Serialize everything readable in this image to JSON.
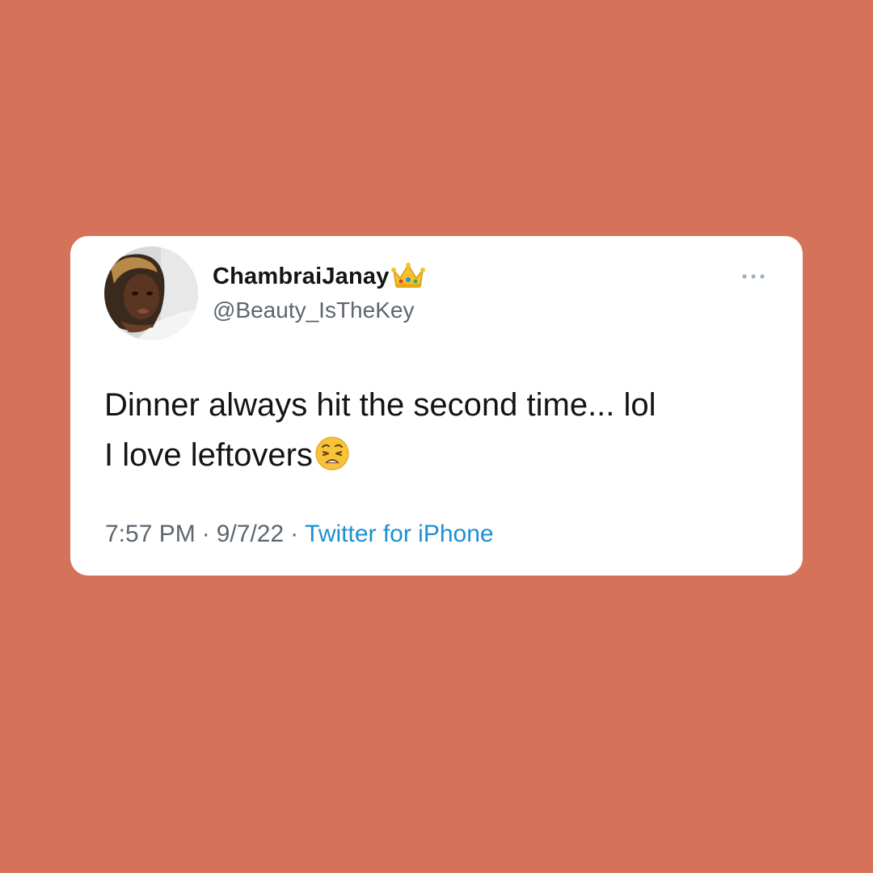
{
  "tweet": {
    "display_name": "ChambraiJanay",
    "name_badge_icon": "crown-emoji-icon",
    "handle": "@Beauty_IsTheKey",
    "text_lines": [
      "Dinner always hit the second time... lol",
      "I love leftovers"
    ],
    "trailing_emoji_icon": "weary-face-emoji-icon",
    "time": "7:57 PM",
    "date": "9/7/22",
    "separator": "·",
    "source": "Twitter for iPhone",
    "more_icon": "more-horizontal-icon"
  },
  "colors": {
    "background": "#d5735a",
    "card": "#ffffff",
    "text_primary": "#141414",
    "text_secondary": "#5b6670",
    "link": "#1d8fd1"
  }
}
